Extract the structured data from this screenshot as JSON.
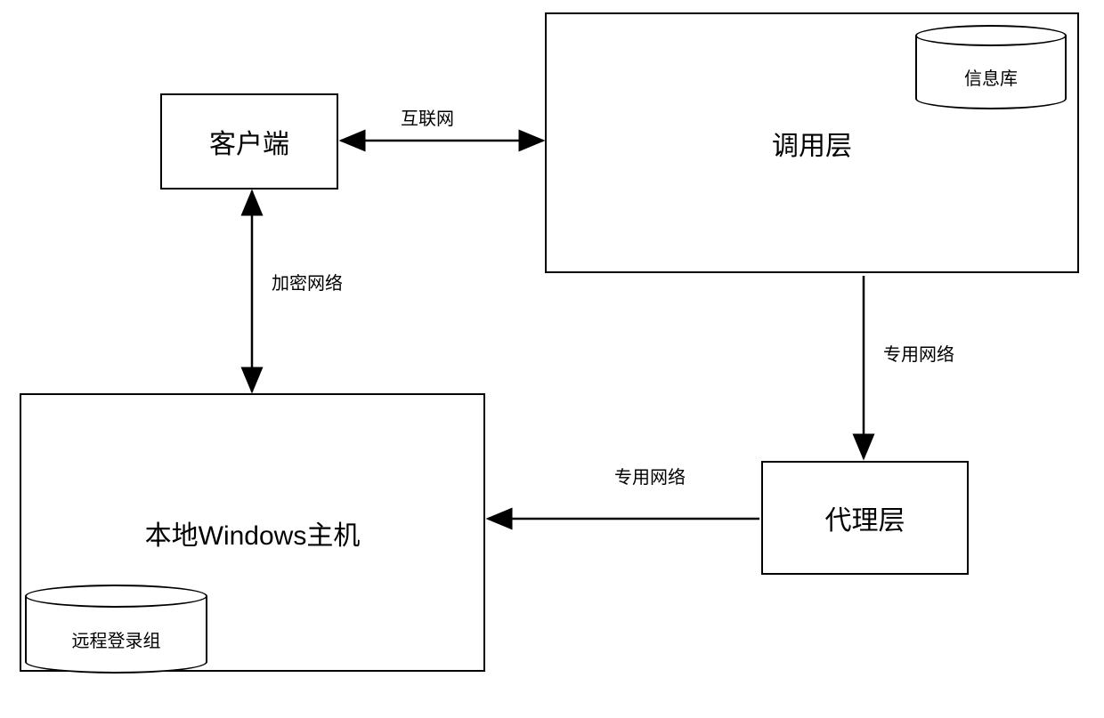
{
  "nodes": {
    "client": {
      "label": "客户端"
    },
    "invoke_layer": {
      "label": "调用层"
    },
    "info_db": {
      "label": "信息库"
    },
    "local_host": {
      "label": "本地Windows主机"
    },
    "remote_group": {
      "label": "远程登录组"
    },
    "proxy_layer": {
      "label": "代理层"
    }
  },
  "edges": {
    "client_invoke": {
      "label": "互联网"
    },
    "client_local": {
      "label": "加密网络"
    },
    "invoke_proxy": {
      "label": "专用网络"
    },
    "proxy_local": {
      "label": "专用网络"
    }
  }
}
